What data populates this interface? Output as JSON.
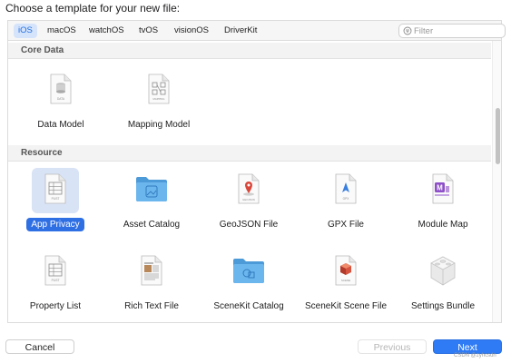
{
  "dialog": {
    "prompt": "Choose a template for your new file:"
  },
  "platform_tabs": [
    {
      "label": "iOS",
      "selected": true
    },
    {
      "label": "macOS",
      "selected": false
    },
    {
      "label": "watchOS",
      "selected": false
    },
    {
      "label": "tvOS",
      "selected": false
    },
    {
      "label": "visionOS",
      "selected": false
    },
    {
      "label": "DriverKit",
      "selected": false
    }
  ],
  "filter": {
    "placeholder": "Filter",
    "value": ""
  },
  "sections": [
    {
      "title": "Core Data",
      "items": [
        {
          "label": "Data Model",
          "icon": "data-model-icon",
          "tag": "DATA",
          "selected": false
        },
        {
          "label": "Mapping Model",
          "icon": "mapping-model-icon",
          "tag": "MAPPING",
          "selected": false
        }
      ]
    },
    {
      "title": "Resource",
      "items": [
        {
          "label": "App Privacy",
          "icon": "plist-icon",
          "tag": "PLIST",
          "selected": true
        },
        {
          "label": "Asset Catalog",
          "icon": "folder-icon",
          "tag": "",
          "selected": false
        },
        {
          "label": "GeoJSON File",
          "icon": "geojson-icon",
          "tag": "GEOJSON",
          "selected": false
        },
        {
          "label": "GPX File",
          "icon": "gpx-icon",
          "tag": "GPX",
          "selected": false
        },
        {
          "label": "Module Map",
          "icon": "module-map-icon",
          "tag": "M",
          "selected": false
        },
        {
          "label": "Property List",
          "icon": "plist-icon",
          "tag": "PLIST",
          "selected": false
        },
        {
          "label": "Rich Text File",
          "icon": "rich-text-icon",
          "tag": "",
          "selected": false
        },
        {
          "label": "SceneKit Catalog",
          "icon": "folder-icon",
          "tag": "",
          "selected": false
        },
        {
          "label": "SceneKit Scene File",
          "icon": "scene-icon",
          "tag": "SCENE",
          "selected": false
        },
        {
          "label": "Settings Bundle",
          "icon": "settings-bundle-icon",
          "tag": "",
          "selected": false
        }
      ]
    }
  ],
  "buttons": {
    "cancel": "Cancel",
    "previous": "Previous",
    "next": "Next"
  },
  "watermark": "CSDN @zyhcsdn",
  "colors": {
    "accent": "#2f7bf5",
    "selection": "#2f6fe4",
    "folder": "#5aa9e6"
  }
}
